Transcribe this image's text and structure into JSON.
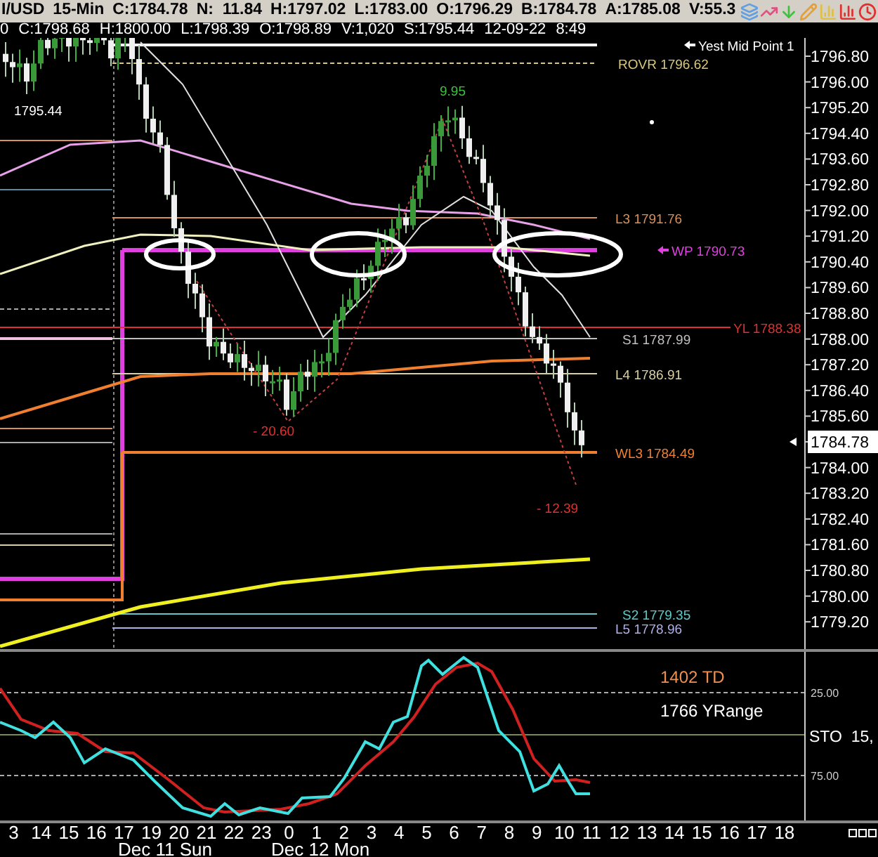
{
  "header": {
    "quote": [
      "I/USD",
      "15-Min",
      "C:1784.78",
      "N:  11.84",
      "H:1797.02",
      "L:1783.00",
      "O:1796.29",
      "B:1784.78",
      "A:1785.08",
      "V:55.3"
    ]
  },
  "info_line": [
    "0",
    "C:1798.68",
    "H:1800.00",
    "L:1798.39",
    "O:1798.89",
    "V:1,020",
    "S:1795.44",
    "12-09-22",
    "8:49"
  ],
  "chart": {
    "price_axis": [
      {
        "text": "1796.80",
        "current": false
      },
      {
        "text": "1796.00",
        "current": false
      },
      {
        "text": "1795.20",
        "current": false
      },
      {
        "text": "1794.40",
        "current": false
      },
      {
        "text": "1793.60",
        "current": false
      },
      {
        "text": "1792.80",
        "current": false
      },
      {
        "text": "1792.00",
        "current": false
      },
      {
        "text": "1791.20",
        "current": false
      },
      {
        "text": "1790.40",
        "current": false
      },
      {
        "text": "1789.60",
        "current": false
      },
      {
        "text": "1788.80",
        "current": false
      },
      {
        "text": "1788.00",
        "current": false
      },
      {
        "text": "1787.20",
        "current": false
      },
      {
        "text": "1786.40",
        "current": false
      },
      {
        "text": "1785.60",
        "current": false
      },
      {
        "text": "1784.78",
        "current": true
      },
      {
        "text": "1784.00",
        "current": false
      },
      {
        "text": "1783.20",
        "current": false
      },
      {
        "text": "1782.40",
        "current": false
      },
      {
        "text": "1781.60",
        "current": false
      },
      {
        "text": "1780.80",
        "current": false
      },
      {
        "text": "1780.00",
        "current": false
      },
      {
        "text": "1779.20",
        "current": false
      }
    ],
    "levels": [
      {
        "label": "Yest Mid Point 1",
        "color": "#ffffff"
      },
      {
        "label": "ROVR 1796.62",
        "color": "#d8c878"
      },
      {
        "label": "L3 1791.76",
        "color": "#d8905a"
      },
      {
        "label": "WP 1790.73",
        "color": "#e040e0"
      },
      {
        "label": "YL 1788.38",
        "color": "#e03030"
      },
      {
        "label": "S1 1787.99",
        "color": "#c0c0c0"
      },
      {
        "label": "L4 1786.91",
        "color": "#d8d0a0"
      },
      {
        "label": "WL3 1784.49",
        "color": "#f08030"
      },
      {
        "label": "S2 1779.35",
        "color": "#60c8c8"
      },
      {
        "label": "L5 1778.96",
        "color": "#b0b0e8"
      }
    ],
    "annotations": [
      {
        "text": "1795.44",
        "color": "#ffffff"
      },
      {
        "text": "9.95",
        "color": "#40c040"
      },
      {
        "text": "- 20.60",
        "color": "#e03030"
      },
      {
        "text": "- 12.39",
        "color": "#e03030"
      }
    ]
  },
  "oscillator": {
    "labels": [
      {
        "text": "1402 TD",
        "color": "#f09050"
      },
      {
        "text": "1766 YRange",
        "color": "#ffffff"
      }
    ],
    "name": "STO  15,",
    "axis": [
      "25.00",
      "75.00"
    ]
  },
  "time_axis": [
    "3",
    "14",
    "15",
    "16",
    "17",
    "19",
    "20",
    "21",
    "22",
    "23",
    "0",
    "1",
    "2",
    "3",
    "4",
    "5",
    "6",
    "7",
    "8",
    "9",
    "10",
    "11",
    "12",
    "13",
    "14",
    "15",
    "16",
    "17",
    "18"
  ],
  "dates": [
    "Dec 11 Sun",
    "Dec 12 Mon"
  ]
}
